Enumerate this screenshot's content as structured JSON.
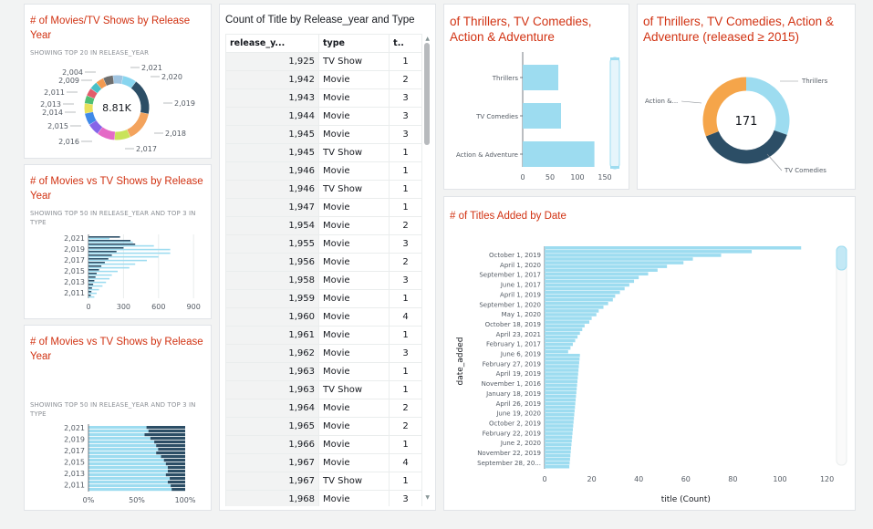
{
  "colors": {
    "title": "#d13212",
    "bar_light": "#9ddcf0",
    "bar_dark": "#2c4e66",
    "donut_orange": "#f5a54a"
  },
  "v1": {
    "title": "# of Movies/TV Shows by Release Year",
    "subtitle": "SHOWING TOP 20 IN RELEASE_YEAR",
    "center": "8.81K",
    "labels_left": [
      "2,004",
      "2,009",
      "2,011",
      "2,013",
      "2,014",
      "2,015",
      "2,016"
    ],
    "labels_right": [
      "2,021",
      "2,020",
      "2,019",
      "2,018",
      "2,017"
    ]
  },
  "v2": {
    "title": "# of Movies vs TV Shows by Release Year",
    "subtitle": "SHOWING TOP 50 IN RELEASE_YEAR AND TOP 3 IN TYPE",
    "y_labels": [
      "2,021",
      "2,019",
      "2,017",
      "2,015",
      "2,013",
      "2,011"
    ],
    "x_labels": [
      "0",
      "300",
      "600",
      "900"
    ]
  },
  "v3": {
    "title": "# of Movies vs TV Shows by Release Year",
    "subtitle": "SHOWING TOP 50 IN RELEASE_YEAR AND TOP 3 IN TYPE",
    "y_labels": [
      "2,021",
      "2,019",
      "2,017",
      "2,015",
      "2,013",
      "2,011"
    ],
    "x_labels": [
      "0%",
      "50%",
      "100%"
    ]
  },
  "table": {
    "title": "Count of Title by Release_year and Type",
    "headers": [
      "release_y...",
      "type",
      "t.."
    ],
    "rows": [
      [
        "1,925",
        "TV Show",
        "1"
      ],
      [
        "1,942",
        "Movie",
        "2"
      ],
      [
        "1,943",
        "Movie",
        "3"
      ],
      [
        "1,944",
        "Movie",
        "3"
      ],
      [
        "1,945",
        "Movie",
        "3"
      ],
      [
        "1,945",
        "TV Show",
        "1"
      ],
      [
        "1,946",
        "Movie",
        "1"
      ],
      [
        "1,946",
        "TV Show",
        "1"
      ],
      [
        "1,947",
        "Movie",
        "1"
      ],
      [
        "1,954",
        "Movie",
        "2"
      ],
      [
        "1,955",
        "Movie",
        "3"
      ],
      [
        "1,956",
        "Movie",
        "2"
      ],
      [
        "1,958",
        "Movie",
        "3"
      ],
      [
        "1,959",
        "Movie",
        "1"
      ],
      [
        "1,960",
        "Movie",
        "4"
      ],
      [
        "1,961",
        "Movie",
        "1"
      ],
      [
        "1,962",
        "Movie",
        "3"
      ],
      [
        "1,963",
        "Movie",
        "1"
      ],
      [
        "1,963",
        "TV Show",
        "1"
      ],
      [
        "1,964",
        "Movie",
        "2"
      ],
      [
        "1,965",
        "Movie",
        "2"
      ],
      [
        "1,966",
        "Movie",
        "1"
      ],
      [
        "1,967",
        "Movie",
        "4"
      ],
      [
        "1,967",
        "TV Show",
        "1"
      ],
      [
        "1,968",
        "Movie",
        "3"
      ]
    ]
  },
  "v4": {
    "title": "of Thrillers, TV Comedies, Action & Adventure",
    "categories": [
      "Thrillers",
      "TV Comedies",
      "Action & Adventure"
    ],
    "x_labels": [
      "0",
      "50",
      "100",
      "150"
    ]
  },
  "v5": {
    "title": "of Thrillers, TV Comedies, Action & Adventure (released ≥ 2015)",
    "center": "171",
    "label_thrillers": "Thrillers",
    "label_action": "Action &...",
    "label_comedies": "TV Comedies"
  },
  "v6": {
    "title": "# of Titles Added by Date",
    "y_axis_title": "date_added",
    "x_axis_title": "title (Count)",
    "x_labels": [
      "0",
      "20",
      "40",
      "60",
      "80",
      "100",
      "120"
    ],
    "date_labels": [
      "October 1, 2019",
      "April 1, 2020",
      "September 1, 2017",
      "June 1, 2017",
      "April 1, 2019",
      "September 1, 2020",
      "May 1, 2020",
      "October 18, 2019",
      "April 23, 2021",
      "February 1, 2017",
      "June 6, 2019",
      "February 27, 2019",
      "April 19, 2019",
      "November 1, 2016",
      "January 18, 2019",
      "April 26, 2019",
      "June 19, 2020",
      "October 2, 2019",
      "February 22, 2019",
      "June 2, 2020",
      "November 22, 2019",
      "September 28, 20..."
    ]
  },
  "chart_data": [
    {
      "type": "bar",
      "title": "of Thrillers, TV Comedies, Action & Adventure",
      "categories": [
        "Thrillers",
        "TV Comedies",
        "Action & Adventure"
      ],
      "values": [
        65,
        70,
        131
      ],
      "xlim": [
        0,
        150
      ]
    },
    {
      "type": "pie",
      "title": "of Thrillers, TV Comedies, Action & Adventure (released ≥ 2015)",
      "categories": [
        "Thrillers",
        "TV Comedies",
        "Action &..."
      ],
      "values": [
        52,
        66,
        53
      ],
      "total": 171
    },
    {
      "type": "bar",
      "title": "# of Titles Added by Date",
      "xlabel": "title (Count)",
      "ylabel": "date_added",
      "values": [
        109,
        88,
        75,
        63,
        59,
        52,
        48,
        44,
        40,
        38,
        36,
        34,
        32,
        30,
        29,
        27,
        25,
        23,
        22,
        20,
        19,
        17,
        16,
        15,
        14,
        13,
        12,
        11,
        10
      ],
      "xlim": [
        0,
        120
      ]
    }
  ]
}
